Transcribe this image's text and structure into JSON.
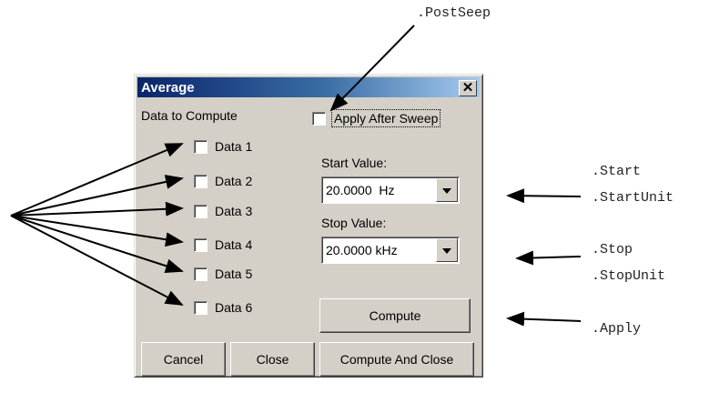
{
  "annotations": {
    "postsweep": ".PostSeep",
    "start": ".Start",
    "start_unit": ".StartUnit",
    "stop": ".Stop",
    "stop_unit": ".StopUnit",
    "apply": ".Apply"
  },
  "dialog": {
    "title": "Average",
    "close_glyph": "✕",
    "data_to_compute_label": "Data to Compute",
    "apply_after_sweep_label": "Apply After Sweep",
    "data_items": [
      "Data 1",
      "Data 2",
      "Data 3",
      "Data 4",
      "Data 5",
      "Data 6"
    ],
    "start_value_label": "Start Value:",
    "start_value": "20.0000  Hz",
    "stop_value_label": "Stop Value:",
    "stop_value": "20.0000 kHz",
    "buttons": {
      "compute": "Compute",
      "cancel": "Cancel",
      "close": "Close",
      "compute_and_close": "Compute And Close"
    }
  }
}
